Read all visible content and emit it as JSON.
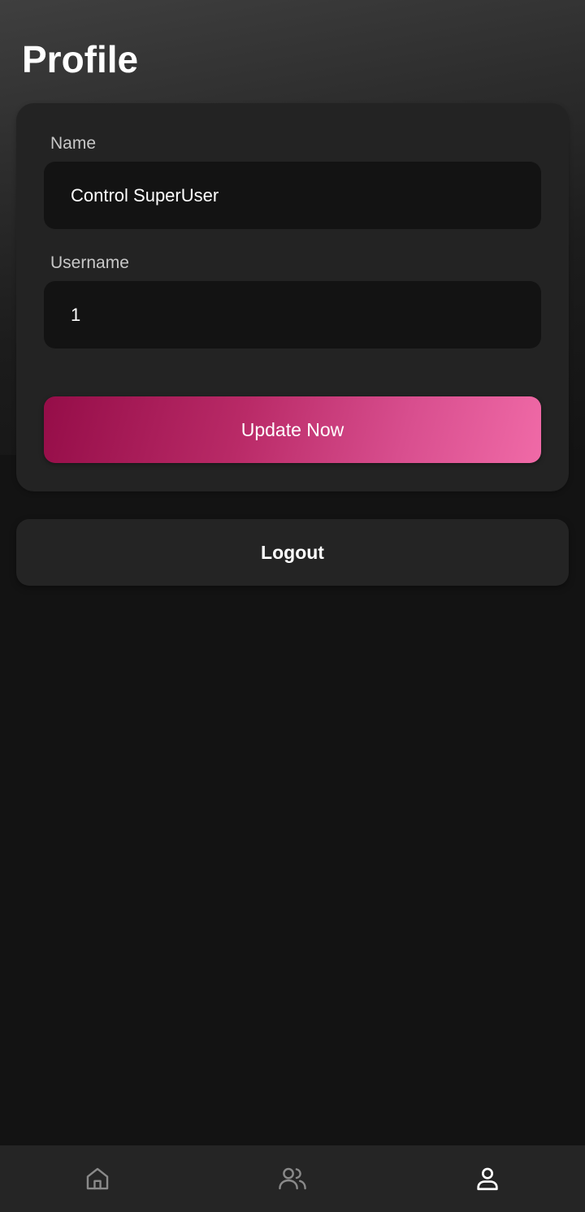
{
  "header": {
    "title": "Profile"
  },
  "form": {
    "name_label": "Name",
    "name_value": "Control SuperUser",
    "username_label": "Username",
    "username_value": "1",
    "update_label": "Update Now"
  },
  "logout_label": "Logout",
  "bottom_nav": {
    "items": [
      {
        "icon": "home-icon",
        "active": false
      },
      {
        "icon": "users-icon",
        "active": false
      },
      {
        "icon": "user-icon",
        "active": true
      }
    ]
  },
  "colors": {
    "background": "#131313",
    "card": "#232323",
    "input": "#131313",
    "accent_start": "#950d48",
    "accent_end": "#f06aa7",
    "nav_active": "#ffffff",
    "nav_inactive": "#8a8a8a"
  }
}
